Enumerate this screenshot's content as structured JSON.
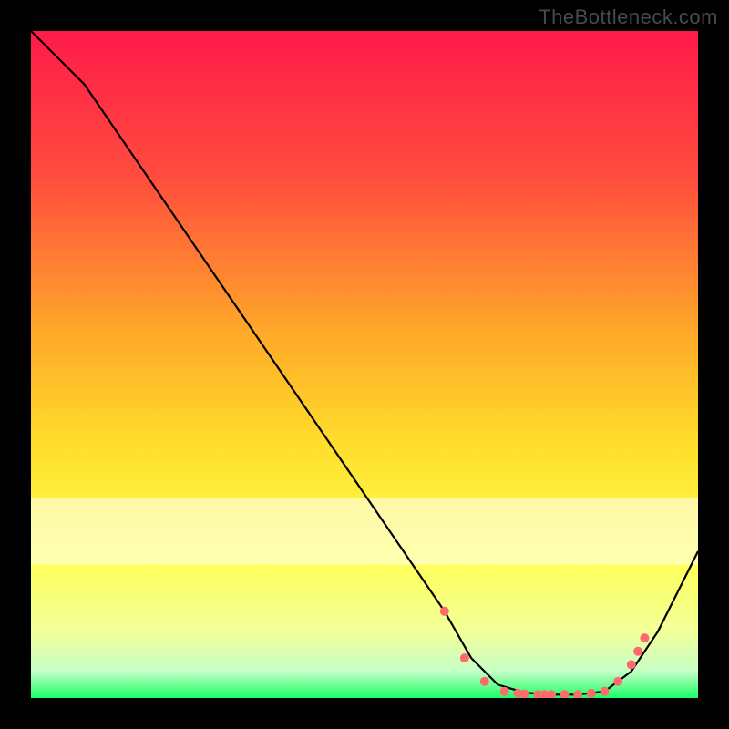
{
  "watermark": "TheBottleneck.com",
  "chart_data": {
    "type": "line",
    "title": "",
    "xlabel": "",
    "ylabel": "",
    "xlim": [
      0,
      100
    ],
    "ylim": [
      0,
      100
    ],
    "background_gradient": {
      "stops": [
        {
          "offset": 0,
          "color": "#ff1a4a"
        },
        {
          "offset": 0.22,
          "color": "#ff4d3d"
        },
        {
          "offset": 0.45,
          "color": "#ffa829"
        },
        {
          "offset": 0.62,
          "color": "#ffde2b"
        },
        {
          "offset": 0.78,
          "color": "#ffff4d"
        },
        {
          "offset": 0.9,
          "color": "#f3ff99"
        },
        {
          "offset": 0.96,
          "color": "#c6ffc6"
        },
        {
          "offset": 1.0,
          "color": "#1aff66"
        }
      ]
    },
    "white_band": {
      "y_from": 93,
      "y_to": 97
    },
    "series": [
      {
        "name": "curve",
        "type": "line",
        "color": "#000000",
        "points": [
          {
            "x": 0,
            "y": 100
          },
          {
            "x": 8,
            "y": 92
          },
          {
            "x": 62,
            "y": 13
          },
          {
            "x": 66,
            "y": 6
          },
          {
            "x": 70,
            "y": 2
          },
          {
            "x": 74,
            "y": 0.8
          },
          {
            "x": 78,
            "y": 0.5
          },
          {
            "x": 82,
            "y": 0.5
          },
          {
            "x": 86,
            "y": 1
          },
          {
            "x": 90,
            "y": 4
          },
          {
            "x": 94,
            "y": 10
          },
          {
            "x": 100,
            "y": 22
          }
        ]
      },
      {
        "name": "markers",
        "type": "scatter",
        "color": "#ff6b6b",
        "points": [
          {
            "x": 62,
            "y": 13
          },
          {
            "x": 65,
            "y": 6
          },
          {
            "x": 68,
            "y": 2.5
          },
          {
            "x": 71,
            "y": 1
          },
          {
            "x": 73,
            "y": 0.7
          },
          {
            "x": 74,
            "y": 0.6
          },
          {
            "x": 76,
            "y": 0.5
          },
          {
            "x": 77,
            "y": 0.5
          },
          {
            "x": 78,
            "y": 0.5
          },
          {
            "x": 80,
            "y": 0.5
          },
          {
            "x": 82,
            "y": 0.5
          },
          {
            "x": 84,
            "y": 0.7
          },
          {
            "x": 86,
            "y": 1
          },
          {
            "x": 88,
            "y": 2.5
          },
          {
            "x": 90,
            "y": 5
          },
          {
            "x": 91,
            "y": 7
          },
          {
            "x": 92,
            "y": 9
          }
        ]
      }
    ]
  }
}
